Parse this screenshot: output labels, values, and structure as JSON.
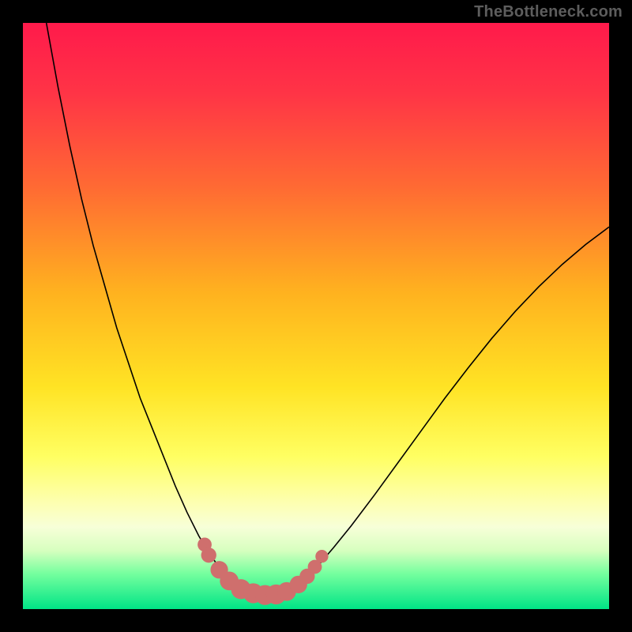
{
  "watermark": {
    "text": "TheBottleneck.com"
  },
  "colors": {
    "frame": "#000000",
    "curve": "#000000",
    "marker": "#cf6f6d",
    "gradient_stops": [
      {
        "pct": 0,
        "color": "#ff1a4b"
      },
      {
        "pct": 12,
        "color": "#ff3446"
      },
      {
        "pct": 28,
        "color": "#ff6a33"
      },
      {
        "pct": 46,
        "color": "#ffb21f"
      },
      {
        "pct": 62,
        "color": "#ffe324"
      },
      {
        "pct": 74,
        "color": "#ffff62"
      },
      {
        "pct": 82,
        "color": "#fdffb2"
      },
      {
        "pct": 86,
        "color": "#f7ffd8"
      },
      {
        "pct": 90,
        "color": "#d7ffbf"
      },
      {
        "pct": 94,
        "color": "#74ff9e"
      },
      {
        "pct": 100,
        "color": "#00e486"
      }
    ]
  },
  "chart_data": {
    "type": "line",
    "title": "",
    "xlabel": "",
    "ylabel": "",
    "xlim": [
      0,
      100
    ],
    "ylim": [
      0,
      100
    ],
    "grid": false,
    "legend": false,
    "series": [
      {
        "name": "left-branch",
        "comment": "steep descending curve from top-left into the valley; y=0 is top, y=100 is bottom",
        "x": [
          4,
          6,
          8,
          10,
          12,
          14,
          16,
          18,
          20,
          22,
          24,
          26,
          28,
          30,
          31,
          32,
          33,
          34,
          35,
          36,
          37,
          38
        ],
        "y": [
          0,
          11,
          21,
          30,
          38,
          45,
          52,
          58,
          64,
          69,
          74,
          79,
          83.5,
          87.5,
          89.2,
          90.8,
          92.2,
          93.4,
          94.4,
          95.3,
          96.0,
          96.6
        ]
      },
      {
        "name": "valley",
        "comment": "flat bottom segment",
        "x": [
          38,
          39,
          40,
          41,
          42,
          43,
          44,
          45,
          46
        ],
        "y": [
          96.6,
          97.0,
          97.3,
          97.5,
          97.6,
          97.5,
          97.3,
          97.0,
          96.6
        ]
      },
      {
        "name": "right-branch",
        "comment": "gentler ascending curve out to the right edge",
        "x": [
          46,
          48,
          50,
          53,
          56,
          60,
          64,
          68,
          72,
          76,
          80,
          84,
          88,
          92,
          96,
          100
        ],
        "y": [
          96.6,
          95.0,
          93.0,
          89.5,
          85.8,
          80.5,
          75.0,
          69.5,
          64.0,
          58.8,
          53.8,
          49.2,
          45.0,
          41.2,
          37.8,
          34.8
        ]
      }
    ],
    "markers": {
      "name": "salmon-beads",
      "comment": "dots clustered around the valley on both sides",
      "points": [
        {
          "x": 31.0,
          "y": 89.0,
          "r": 1.2
        },
        {
          "x": 31.7,
          "y": 90.8,
          "r": 1.3
        },
        {
          "x": 33.5,
          "y": 93.3,
          "r": 1.5
        },
        {
          "x": 35.2,
          "y": 95.2,
          "r": 1.6
        },
        {
          "x": 37.2,
          "y": 96.6,
          "r": 1.7
        },
        {
          "x": 39.3,
          "y": 97.3,
          "r": 1.7
        },
        {
          "x": 41.3,
          "y": 97.6,
          "r": 1.7
        },
        {
          "x": 43.2,
          "y": 97.5,
          "r": 1.7
        },
        {
          "x": 45.0,
          "y": 97.0,
          "r": 1.6
        },
        {
          "x": 47.0,
          "y": 95.8,
          "r": 1.5
        },
        {
          "x": 48.5,
          "y": 94.4,
          "r": 1.3
        },
        {
          "x": 49.8,
          "y": 92.8,
          "r": 1.2
        },
        {
          "x": 51.0,
          "y": 91.0,
          "r": 1.1
        }
      ]
    }
  }
}
